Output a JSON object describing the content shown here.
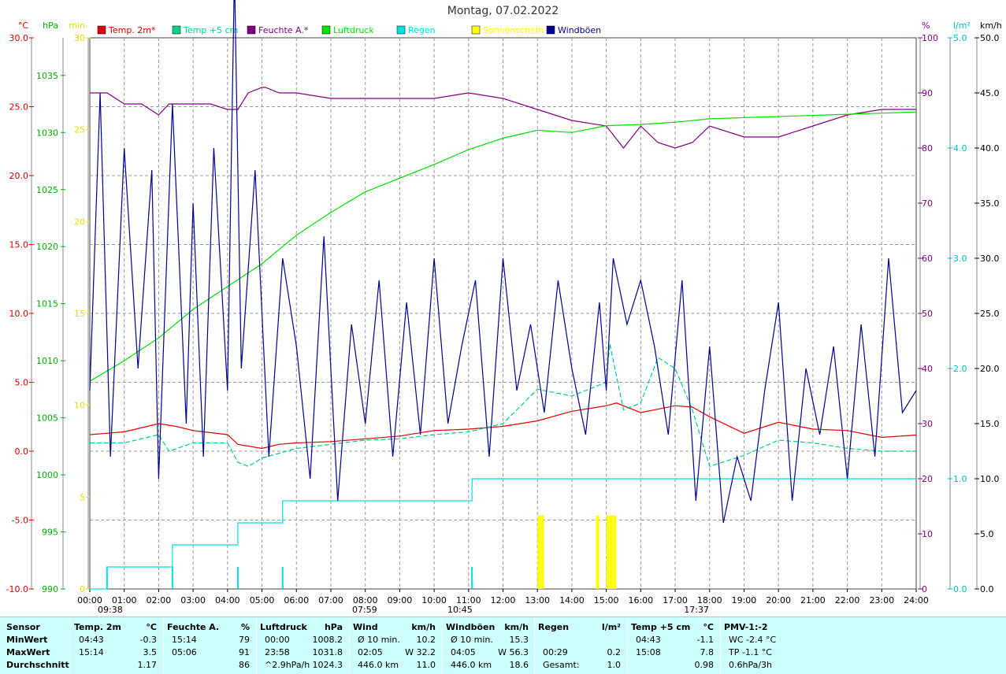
{
  "title": "Montag, 07.02.2022",
  "legend": [
    {
      "label": "Temp. 2m*",
      "color": "#e00000"
    },
    {
      "label": "Temp +5 cm",
      "color": "#00d080"
    },
    {
      "label": "Feuchte A.*",
      "color": "#800080"
    },
    {
      "label": "Luftdruck",
      "color": "#00e000"
    },
    {
      "label": "Regen",
      "color": "#00e0e0"
    },
    {
      "label": "Sonnenschein",
      "color": "#ffff00"
    },
    {
      "label": "Windböen",
      "color": "#000090"
    }
  ],
  "axes": {
    "temp": {
      "unit": "°C",
      "ticks": [
        "30.0",
        "25.0",
        "20.0",
        "15.0",
        "10.0",
        "5.0",
        "0.0",
        "-5.0",
        "-10.0"
      ],
      "color": "#e00000"
    },
    "pressure": {
      "unit": "hPa",
      "ticks": [
        "1035",
        "1030",
        "1025",
        "1020",
        "1015",
        "1010",
        "1005",
        "1000",
        "995",
        "990"
      ],
      "color": "#00b000"
    },
    "sun": {
      "unit": "min",
      "ticks": [
        "30",
        "25",
        "20",
        "15",
        "10",
        "5",
        "0"
      ],
      "color": "#e0e000"
    },
    "humidity": {
      "unit": "%",
      "ticks": [
        "100",
        "90",
        "80",
        "70",
        "60",
        "50",
        "40",
        "30",
        "20",
        "10",
        "0"
      ],
      "color": "#800080"
    },
    "rain": {
      "unit": "l/m²",
      "ticks": [
        "5.0",
        "4.0",
        "3.0",
        "2.0",
        "1.0",
        "0.0"
      ],
      "color": "#00c0c0"
    },
    "wind": {
      "unit": "km/h",
      "ticks": [
        "50.0",
        "45.0",
        "40.0",
        "35.0",
        "30.0",
        "25.0",
        "20.0",
        "15.0",
        "10.0",
        "5.0",
        "0.0"
      ],
      "color": "#000"
    },
    "time": {
      "ticks": [
        "00:00",
        "01:00",
        "02:00",
        "03:00",
        "04:00",
        "05:00",
        "06:00",
        "07:00",
        "08:00",
        "09:00",
        "10:00",
        "11:00",
        "12:00",
        "13:00",
        "14:00",
        "15:00",
        "16:00",
        "17:00",
        "18:00",
        "19:00",
        "20:00",
        "21:00",
        "22:00",
        "23:00",
        "24:00"
      ]
    },
    "markers": [
      {
        "label": "09:38",
        "hour": 0
      },
      {
        "label": "07:59",
        "hour": 7.98
      },
      {
        "label": "10:45",
        "hour": 10.75
      },
      {
        "label": "17:37",
        "hour": 17.62
      }
    ]
  },
  "chart_data": {
    "type": "line",
    "x_unit": "hour",
    "xlim": [
      0,
      24
    ],
    "series": [
      {
        "name": "Temp. 2m*",
        "axis": "temp",
        "color": "#e00000",
        "x": [
          0,
          1,
          2,
          2.5,
          3,
          4,
          4.3,
          5,
          5.5,
          6,
          7,
          8,
          9,
          10,
          11,
          12,
          13,
          14,
          15,
          15.3,
          16,
          17,
          17.5,
          18,
          19,
          20,
          21,
          22,
          23,
          24
        ],
        "y": [
          1.2,
          1.4,
          2.0,
          1.8,
          1.5,
          1.2,
          0.5,
          0.2,
          0.5,
          0.6,
          0.7,
          0.9,
          1.1,
          1.5,
          1.6,
          1.8,
          2.2,
          2.9,
          3.3,
          3.5,
          2.8,
          3.3,
          3.2,
          2.5,
          1.3,
          2.1,
          1.6,
          1.5,
          1.0,
          1.17
        ]
      },
      {
        "name": "Temp +5 cm",
        "axis": "temp",
        "color": "#00d080",
        "x": [
          0,
          1,
          2,
          2.3,
          3,
          4,
          4.3,
          4.6,
          5,
          6,
          7,
          8,
          9,
          10,
          11,
          12,
          13,
          14,
          15,
          15.1,
          15.5,
          16,
          16.5,
          17,
          17.5,
          18,
          19,
          20,
          21,
          22,
          23,
          24
        ],
        "y": [
          0.6,
          0.6,
          1.2,
          0.0,
          0.6,
          0.6,
          -0.8,
          -1.1,
          -0.5,
          0.2,
          0.5,
          0.8,
          0.9,
          1.2,
          1.4,
          2.0,
          4.5,
          4.0,
          5.0,
          7.8,
          3.0,
          3.5,
          6.8,
          6.0,
          3.0,
          -1.1,
          -0.3,
          0.8,
          0.6,
          0.2,
          0.0,
          0.0
        ]
      },
      {
        "name": "Feuchte A.*",
        "axis": "humidity",
        "color": "#800080",
        "x": [
          0,
          0.5,
          1,
          1.5,
          2,
          2.3,
          3,
          3.5,
          4,
          4.3,
          4.6,
          5,
          5.1,
          5.5,
          6,
          7,
          8,
          9,
          10,
          11,
          12,
          13,
          14,
          15,
          15.5,
          16,
          16.5,
          17,
          17.5,
          18,
          19,
          20,
          21,
          22,
          23,
          24
        ],
        "y": [
          90,
          90,
          88,
          88,
          86,
          88,
          88,
          88,
          87,
          87,
          90,
          91,
          91,
          90,
          90,
          89,
          89,
          89,
          89,
          90,
          89,
          87,
          85,
          84,
          80,
          84,
          81,
          80,
          81,
          84,
          82,
          82,
          84,
          86,
          87,
          87
        ]
      },
      {
        "name": "Luftdruck",
        "axis": "pressure",
        "color": "#00e000",
        "x": [
          0,
          1,
          2,
          3,
          4,
          5,
          6,
          7,
          8,
          9,
          10,
          11,
          12,
          13,
          14,
          15,
          16,
          17,
          18,
          19,
          20,
          21,
          22,
          23,
          24
        ],
        "y": [
          1008.2,
          1010,
          1012,
          1014.5,
          1016.5,
          1018.5,
          1021,
          1023,
          1024.8,
          1026,
          1027.2,
          1028.5,
          1029.5,
          1030.2,
          1030,
          1030.6,
          1030.7,
          1030.9,
          1031.2,
          1031.3,
          1031.4,
          1031.5,
          1031.6,
          1031.7,
          1031.8
        ]
      },
      {
        "name": "Regen",
        "axis": "rain",
        "color": "#00e0e0",
        "x": [
          0,
          0.5,
          1,
          2,
          2.4,
          3,
          4,
          4.3,
          5,
          5.6,
          6,
          7,
          8,
          9,
          10,
          11,
          11.1,
          12,
          13,
          14,
          15,
          16,
          17,
          18,
          19,
          20,
          21,
          22,
          23,
          24
        ],
        "y": [
          0,
          0.2,
          0.2,
          0.2,
          0.4,
          0.4,
          0.4,
          0.6,
          0.6,
          0.8,
          0.8,
          0.8,
          0.8,
          0.8,
          0.8,
          0.8,
          1.0,
          1.0,
          1.0,
          1.0,
          1.0,
          1.0,
          1.0,
          1.0,
          1.0,
          1.0,
          1.0,
          1.0,
          1.0,
          1.0
        ]
      },
      {
        "name": "Windböen",
        "axis": "wind",
        "color": "#000090",
        "x": [
          0,
          0.3,
          0.6,
          1,
          1.4,
          1.8,
          2,
          2.4,
          2.8,
          3,
          3.3,
          3.6,
          4,
          4.2,
          4.4,
          4.8,
          5.2,
          5.6,
          6,
          6.4,
          6.8,
          7.2,
          7.6,
          8,
          8.4,
          8.8,
          9.2,
          9.6,
          10,
          10.4,
          10.8,
          11.2,
          11.6,
          12,
          12.4,
          12.8,
          13.2,
          13.6,
          14,
          14.4,
          14.8,
          15,
          15.2,
          15.6,
          16,
          16.4,
          16.8,
          17.2,
          17.6,
          18,
          18.4,
          18.8,
          19.2,
          19.6,
          20,
          20.4,
          20.8,
          21.2,
          21.6,
          22,
          22.4,
          22.8,
          23.2,
          23.6,
          24
        ],
        "y": [
          18,
          45,
          12,
          40,
          20,
          38,
          10,
          44,
          15,
          35,
          12,
          40,
          18,
          56,
          20,
          38,
          12,
          30,
          22,
          10,
          32,
          8,
          24,
          15,
          28,
          12,
          26,
          14,
          30,
          15,
          22,
          28,
          12,
          30,
          18,
          24,
          16,
          28,
          20,
          14,
          26,
          18,
          30,
          24,
          28,
          22,
          14,
          28,
          8,
          22,
          6,
          12,
          8,
          18,
          26,
          8,
          20,
          14,
          22,
          10,
          24,
          12,
          30,
          16,
          18
        ]
      }
    ],
    "sunshine_bars": {
      "axis": "sun",
      "unit": "min",
      "x": [
        13.0,
        13.1,
        14.7,
        15.0,
        15.1,
        15.2
      ],
      "y": [
        4,
        4,
        4,
        4,
        4,
        4
      ]
    },
    "rain_events": {
      "axis": "rain",
      "x": [
        0.5,
        2.4,
        4.3,
        5.6,
        11.1
      ],
      "y": [
        0.2,
        0.2,
        0.2,
        0.2,
        0.2
      ]
    }
  },
  "table": {
    "rows": [
      "Sensor",
      "MinWert",
      "MaxWert",
      "Durchschnitt"
    ],
    "columns": [
      {
        "head": "Temp. 2m",
        "unit": "°C",
        "cells": [
          [
            "04:43",
            "-0.3"
          ],
          [
            "15:14",
            "3.5"
          ],
          [
            "",
            "1.17"
          ]
        ]
      },
      {
        "head": "Feuchte A.",
        "unit": "%",
        "cells": [
          [
            "15:14",
            "79"
          ],
          [
            "05:06",
            "91"
          ],
          [
            "",
            "86"
          ]
        ]
      },
      {
        "head": "Luftdruck",
        "unit": "hPa",
        "cells": [
          [
            "00:00",
            "1008.2"
          ],
          [
            "23:58",
            "1031.8"
          ],
          [
            "^2.9hPa/h",
            "1024.3"
          ]
        ]
      },
      {
        "head": "Wind",
        "unit": "km/h",
        "cells": [
          [
            "Ø 10 min.",
            "10.2"
          ],
          [
            "02:05",
            "W 32.2"
          ],
          [
            "446.0 km",
            "11.0"
          ]
        ]
      },
      {
        "head": "Windböen",
        "unit": "km/h",
        "cells": [
          [
            "Ø 10 min.",
            "15.3"
          ],
          [
            "04:05",
            "W 56.3"
          ],
          [
            "446.0 km",
            "18.6"
          ]
        ]
      },
      {
        "head": "Regen",
        "unit": "l/m²",
        "cells": [
          [
            "",
            ""
          ],
          [
            "00:29",
            "0.2"
          ],
          [
            "Gesamt:",
            "1.0"
          ]
        ]
      },
      {
        "head": "Temp +5 cm",
        "unit": "°C",
        "cells": [
          [
            "04:43",
            "-1.1"
          ],
          [
            "15:08",
            "7.8"
          ],
          [
            "",
            "0.98"
          ]
        ]
      },
      {
        "head": "PMV-1:-2",
        "unit": "",
        "cells": [
          [
            "WC -2.4 °C",
            ""
          ],
          [
            "TP -1.1 °C",
            ""
          ],
          [
            "0.6hPa/3h",
            ""
          ]
        ]
      }
    ]
  }
}
